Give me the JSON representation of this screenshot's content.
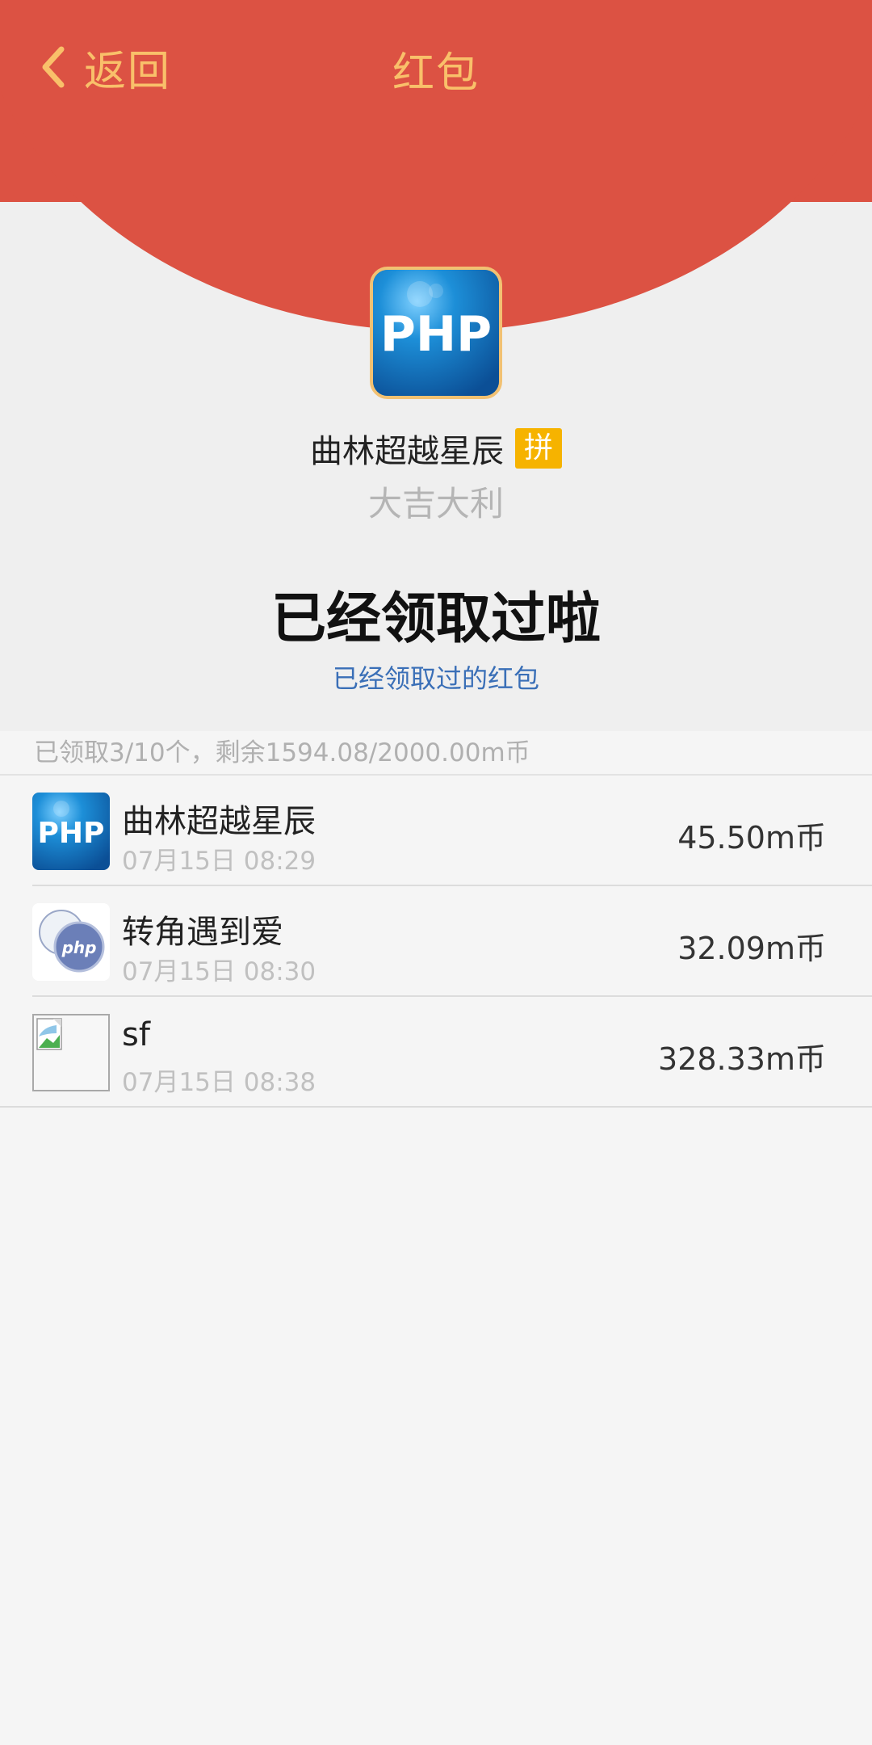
{
  "nav": {
    "back_label": "返回",
    "title": "红包"
  },
  "colors": {
    "red": "#dc5243",
    "gold": "#f9c06a",
    "badge": "#f6b300",
    "link": "#3a6fb7"
  },
  "header": {
    "avatar_text": "PHP",
    "sender_name": "曲林超越星辰",
    "badge": "拼",
    "greeting": "大吉大利",
    "status": "已经领取过啦",
    "link": "已经领取过的红包"
  },
  "summary": "已领取3/10个，剩余1594.08/2000.00m币",
  "records": [
    {
      "name": "曲林超越星辰",
      "time": "07月15日 08:29",
      "amount": "45.50m币",
      "avatar": "php-logo-icon",
      "avatar_text": "PHP"
    },
    {
      "name": "转角遇到爱",
      "time": "07月15日 08:30",
      "amount": "32.09m币",
      "avatar": "php-elephant-icon",
      "avatar_text": "php"
    },
    {
      "name": "sf",
      "time": "07月15日 08:38",
      "amount": "328.33m币",
      "avatar": "broken-image-icon"
    }
  ]
}
